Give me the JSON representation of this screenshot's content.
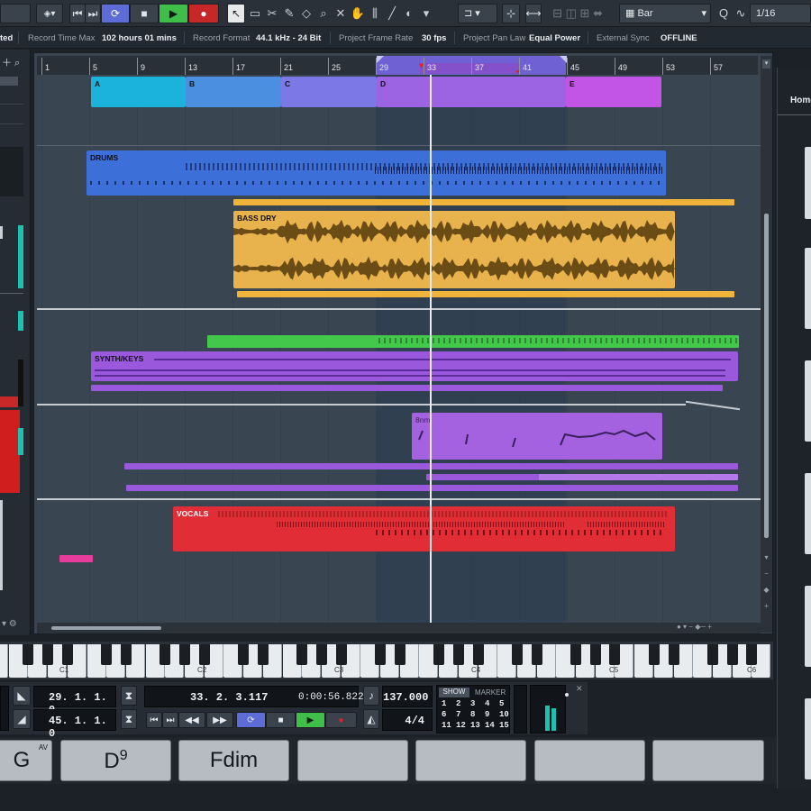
{
  "toolbar": {
    "cycle_label": "⟳",
    "stop_label": "■",
    "play_label": "▶",
    "record_label": "●",
    "prev_label": "⏮",
    "next_label": "⏭",
    "grid_type": "Bar",
    "quantize": "1/16",
    "quantize_prefix": "Q",
    "colors": {
      "play": "#3fbf4a",
      "record": "#c62828",
      "cycle": "#5d6cd6"
    }
  },
  "status": {
    "rec_prefix": "ted",
    "record_time_label": "Record Time Max",
    "record_time_value": "102 hours 01 mins",
    "record_format_label": "Record Format",
    "record_format_value": "44.1 kHz - 24 Bit",
    "frame_rate_label": "Project Frame Rate",
    "frame_rate_value": "30 fps",
    "pan_law_label": "Project Pan Law",
    "pan_law_value": "Equal Power",
    "sync_label": "External Sync",
    "sync_value": "OFFLINE"
  },
  "ruler": {
    "bars": [
      "1",
      "5",
      "9",
      "13",
      "17",
      "21",
      "25",
      "29",
      "33",
      "37",
      "41",
      "45",
      "49",
      "53",
      "57"
    ]
  },
  "arranger": {
    "sections": [
      "A",
      "B",
      "C",
      "D",
      "E"
    ]
  },
  "tracks": {
    "drums": "DRUMS",
    "bass": "BASS DRY",
    "synth": "SYNTH/KEYS",
    "bass_midi": "8nm",
    "vocals": "VOCALS"
  },
  "right_panel": {
    "tab": "Home"
  },
  "keyboard": {
    "octaves": [
      "C1",
      "C2",
      "C3",
      "C4",
      "C5",
      "C6"
    ]
  },
  "transport": {
    "left_locator": "29. 1. 1.   0",
    "right_locator": "45. 1. 1.   0",
    "position_bars": "33.  2.  3.117",
    "position_time": "0:00:56.822",
    "tempo": "137.000",
    "signature": "4/4",
    "show_label": "SHOW",
    "marker_label": "MARKER",
    "marker_numbers": [
      "1",
      "2",
      "3",
      "4",
      "5",
      "6",
      "7",
      "8",
      "9",
      "10",
      "11",
      "12",
      "13",
      "14",
      "15"
    ]
  },
  "chord_pads": {
    "chords": [
      "G",
      "D9",
      "Fdim",
      "",
      "",
      "",
      ""
    ],
    "pad_badge": "AV"
  }
}
